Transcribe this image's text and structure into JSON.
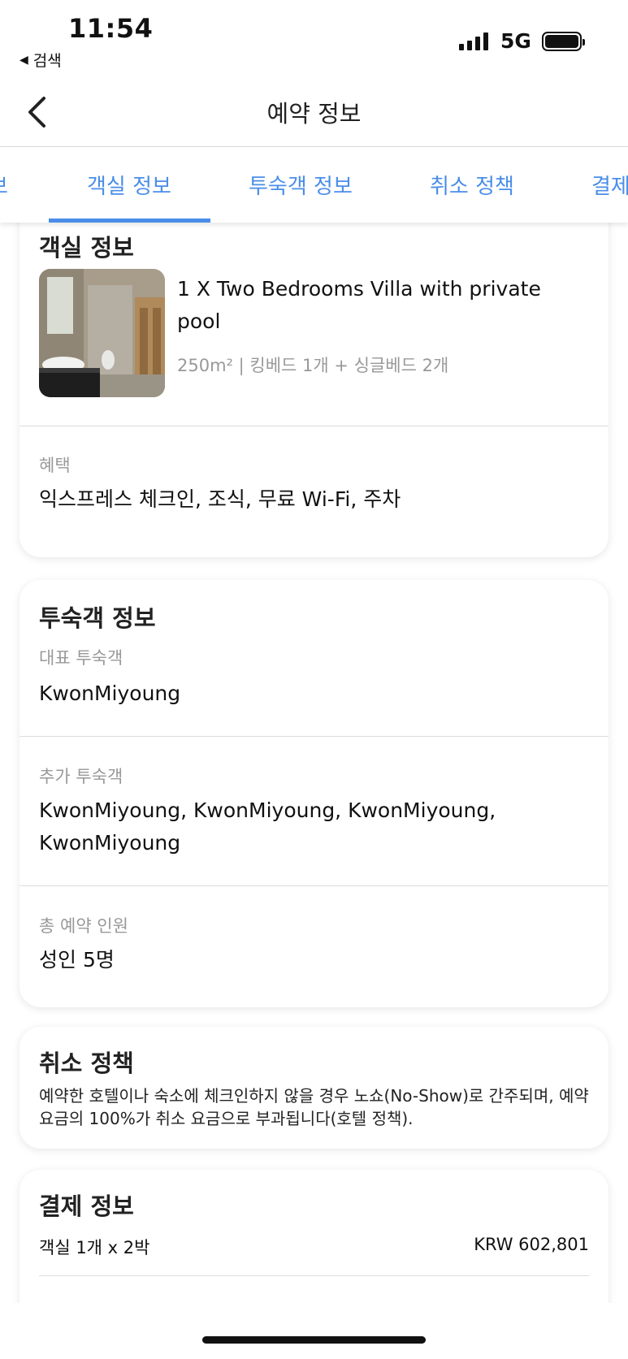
{
  "status_bar": {
    "time": "11:54",
    "back_app": "검색",
    "network": "5G",
    "icons": [
      "cellular-signal-icon",
      "battery-icon"
    ]
  },
  "nav": {
    "title": "예약 정보",
    "back_icon": "chevron-left-icon"
  },
  "tabs": [
    {
      "label": "보",
      "active": false
    },
    {
      "label": "객실 정보",
      "active": true
    },
    {
      "label": "투숙객 정보",
      "active": false
    },
    {
      "label": "취소 정책",
      "active": false
    },
    {
      "label": "결제",
      "active": false
    }
  ],
  "room_info": {
    "title": "객실 정보",
    "room_name": "1 X Two Bedrooms Villa with private pool",
    "room_detail": "250m² | 킹베드 1개 + 싱글베드 2개",
    "benefits_label": "혜택",
    "benefits": "익스프레스 체크인, 조식, 무료 Wi-Fi, 주차"
  },
  "guest_info": {
    "title": "투숙객 정보",
    "lead_label": "대표 투숙객",
    "lead_guest": "KwonMiyoung",
    "additional_label": "추가 투숙객",
    "additional_guests": "KwonMiyoung, KwonMiyoung, KwonMiyoung, KwonMiyoung",
    "total_label": "총 예약 인원",
    "total": "성인 5명"
  },
  "cancel_policy": {
    "title": "취소 정책",
    "text": "예약한 호텔이나 숙소에 체크인하지 않을 경우 노쇼(No-Show)로 간주되며, 예약 요금의 100%가 취소 요금으로 부과됩니다(호텔 정책)."
  },
  "payment": {
    "title": "결제 정보",
    "line_label": "객실 1개 x 2박",
    "line_value": "KRW 602,801"
  },
  "colors": {
    "accent": "#4a8ee8",
    "muted_text": "#999999"
  }
}
